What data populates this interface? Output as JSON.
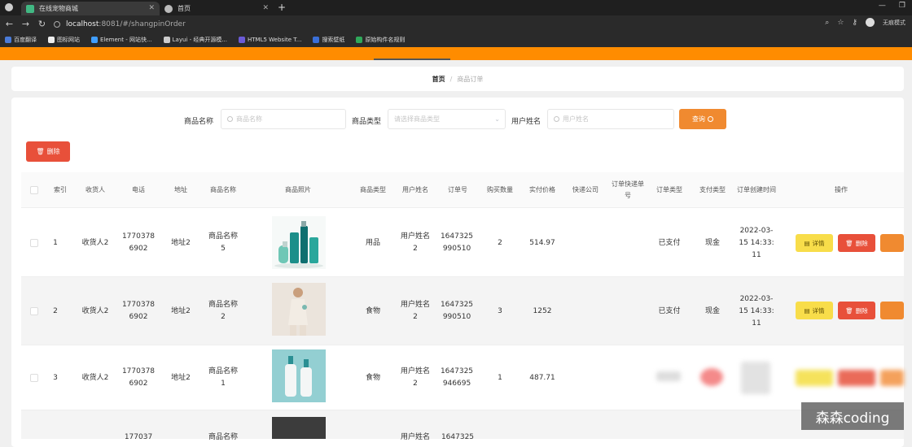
{
  "browser": {
    "tabs": [
      {
        "title": "在线宠物商城",
        "active": true
      },
      {
        "title": "首页",
        "active": false
      }
    ],
    "new_tab": "+",
    "url_host": "localhost",
    "url_path": ":8081/#/shangpinOrder",
    "profile": "无痕模式",
    "bookmarks": [
      "百度翻译",
      "图标网站",
      "Element - 网站快...",
      "Layui - 经典开源模...",
      "HTML5 Website T...",
      "搜索壁纸",
      "原始构件名规则"
    ]
  },
  "breadcrumb": {
    "home": "首页",
    "separator": "/",
    "current": "商品订单"
  },
  "search": {
    "name_label": "商品名称",
    "name_placeholder": "商品名称",
    "type_label": "商品类型",
    "type_placeholder": "请选择商品类型",
    "user_label": "用户姓名",
    "user_placeholder": "用户姓名",
    "query_button": "查询"
  },
  "toolbar": {
    "delete_button": "删除"
  },
  "table": {
    "columns": [
      "索引",
      "收货人",
      "电话",
      "地址",
      "商品名称",
      "商品照片",
      "商品类型",
      "用户姓名",
      "订单号",
      "购买数量",
      "实付价格",
      "快递公司",
      "订单快递单号",
      "订单类型",
      "支付类型",
      "订单创建时间",
      "操作"
    ],
    "rows": [
      {
        "index": "1",
        "receiver": "收货人2",
        "phone": "17703786902",
        "address": "地址2",
        "name": "商品名称5",
        "type": "用品",
        "user": "用户姓名2",
        "order_no": "1647325990510",
        "qty": "2",
        "price": "514.97",
        "express": "",
        "express_no": "",
        "order_type": "已支付",
        "pay_type": "现金",
        "created": "2022-03-15 14:33:11"
      },
      {
        "index": "2",
        "receiver": "收货人2",
        "phone": "17703786902",
        "address": "地址2",
        "name": "商品名称2",
        "type": "食物",
        "user": "用户姓名2",
        "order_no": "1647325990510",
        "qty": "3",
        "price": "1252",
        "express": "",
        "express_no": "",
        "order_type": "已支付",
        "pay_type": "现金",
        "created": "2022-03-15 14:33:11"
      },
      {
        "index": "3",
        "receiver": "收货人2",
        "phone": "17703786902",
        "address": "地址2",
        "name": "商品名称1",
        "type": "食物",
        "user": "用户姓名2",
        "order_no": "1647325946695",
        "qty": "1",
        "price": "487.71",
        "express": "",
        "express_no": "",
        "order_type": "",
        "pay_type": "",
        "created": ""
      },
      {
        "index": "",
        "receiver": "",
        "phone": "177037",
        "address": "",
        "name": "商品名称",
        "type": "",
        "user": "用户姓名",
        "order_no": "1647325",
        "qty": "",
        "price": "",
        "express": "",
        "express_no": "",
        "order_type": "",
        "pay_type": "",
        "created": ""
      }
    ],
    "actions": {
      "detail": "详情",
      "delete": "删除"
    }
  },
  "watermark": "森森coding",
  "colors": {
    "accent": "#ff8c00",
    "danger": "#e8503a",
    "warning": "#f5d547",
    "query": "#f08a30"
  }
}
